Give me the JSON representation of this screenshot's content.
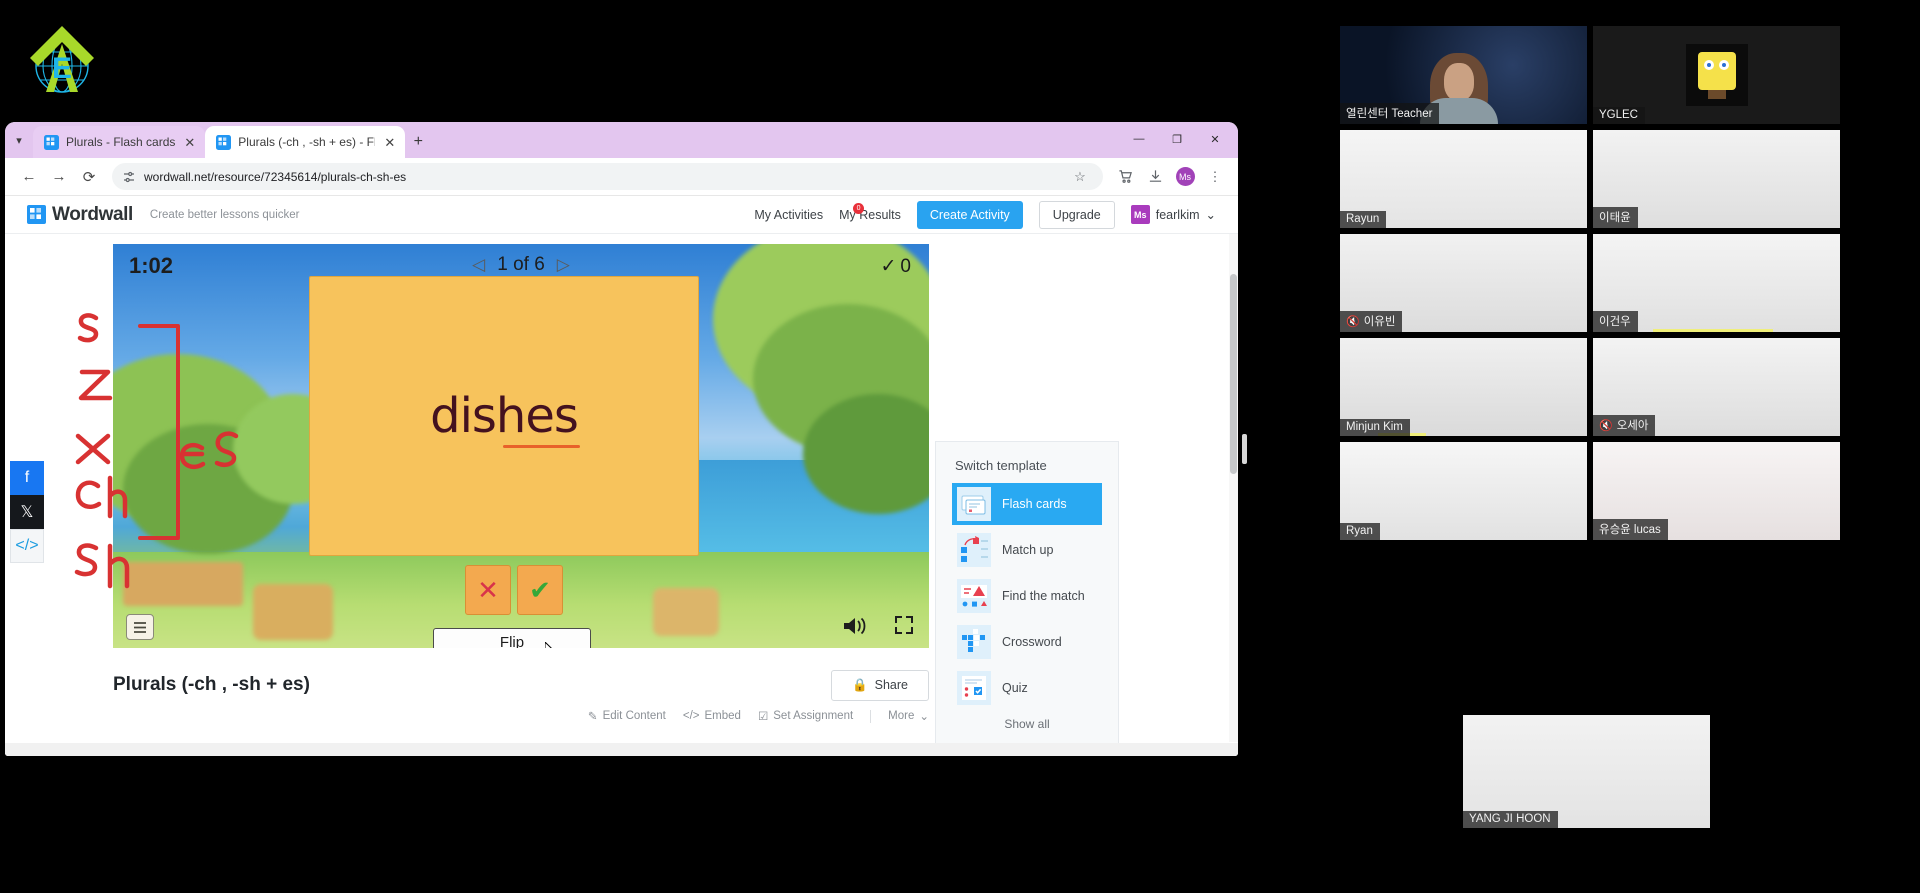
{
  "browser": {
    "tabs": [
      {
        "title": "Plurals - Flash cards",
        "active": false
      },
      {
        "title": "Plurals (-ch , -sh + es) - Flash c",
        "active": true
      }
    ],
    "new_tab_label": "+",
    "window_controls": {
      "minimize": "—",
      "maximize": "❐",
      "close": "✕"
    },
    "url": "wordwall.net/resource/72345614/plurals-ch-sh-es",
    "back": "←",
    "forward": "→",
    "reload": "⟳",
    "bookmark_star": "☆",
    "profile_initial": "Ms"
  },
  "wordwall": {
    "brand": "Wordwall",
    "tagline": "Create better lessons quicker",
    "nav": [
      {
        "label": "My Activities",
        "badge": ""
      },
      {
        "label": "My Results",
        "badge": "0"
      }
    ],
    "create_button": "Create Activity",
    "upgrade_button": "Upgrade",
    "user": {
      "initials": "Ms",
      "name": "fearlkim",
      "chevron": "⌄"
    }
  },
  "social": [
    {
      "name": "facebook-share",
      "glyph": "f"
    },
    {
      "name": "x-share",
      "glyph": "𝕏"
    },
    {
      "name": "embed-code",
      "glyph": "</>"
    }
  ],
  "game": {
    "timer": "1:02",
    "prev_arrow": "◁",
    "position": "1 of 6",
    "next_arrow": "▷",
    "score_check": "✓",
    "score": "0",
    "card_word": "dishes",
    "wrong_button": "✕",
    "correct_button": "✔",
    "flip_button": "Flip",
    "sound_icon": "🔊",
    "fullscreen_icon": "⤡",
    "menu_icon": "☰"
  },
  "annotations": {
    "endings": [
      "s",
      "z",
      "x",
      "ch",
      "sh"
    ],
    "result": "es",
    "color": "#d83232"
  },
  "activity": {
    "title": "Plurals (-ch , -sh + es)",
    "share_label": "Share",
    "share_icon": "🔒",
    "actions": [
      {
        "label": "Edit Content",
        "icon": "✎"
      },
      {
        "label": "Embed",
        "icon": "</>"
      },
      {
        "label": "Set Assignment",
        "icon": "☑"
      },
      {
        "label": "More",
        "icon": "⌄"
      }
    ]
  },
  "switch_template": {
    "title": "Switch template",
    "items": [
      {
        "label": "Flash cards",
        "selected": true
      },
      {
        "label": "Match up",
        "selected": false
      },
      {
        "label": "Find the match",
        "selected": false
      },
      {
        "label": "Crossword",
        "selected": false
      },
      {
        "label": "Quiz",
        "selected": false
      }
    ],
    "show_all": "Show all"
  },
  "meeting": {
    "participants": [
      {
        "name": "열린센터 Teacher",
        "muted": false,
        "active": false,
        "video": "teacher"
      },
      {
        "name": "YGLEC",
        "muted": false,
        "active": false,
        "video": "spongebob"
      },
      {
        "name": "Rayun",
        "muted": false,
        "active": false,
        "video": "room"
      },
      {
        "name": "이태윤",
        "muted": false,
        "active": false,
        "video": "room"
      },
      {
        "name": "이유빈",
        "muted": true,
        "active": false,
        "video": "room"
      },
      {
        "name": "이건우",
        "muted": false,
        "active": false,
        "video": "room"
      },
      {
        "name": "Minjun Kim",
        "muted": false,
        "active": false,
        "video": "room"
      },
      {
        "name": "오세아",
        "muted": true,
        "active": false,
        "video": "room"
      },
      {
        "name": "Ryan",
        "muted": false,
        "active": false,
        "video": "room"
      },
      {
        "name": "유승윤 lucas",
        "muted": false,
        "active": false,
        "video": "room"
      }
    ],
    "spotlight": {
      "name": "YANG JI HOON",
      "active": true
    }
  },
  "colors": {
    "accent_blue": "#29a3f0",
    "card_yellow": "#f7c35c",
    "annotation_red": "#d83232",
    "active_speaker_green": "#a8e030",
    "brand_purple": "#a93bbd"
  }
}
